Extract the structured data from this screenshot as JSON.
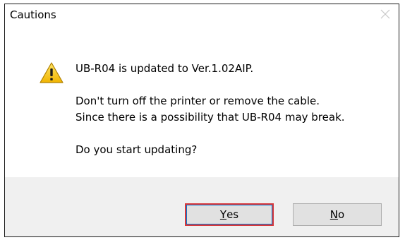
{
  "window": {
    "title": "Cautions"
  },
  "message": {
    "line1": "UB-R04 is updated to Ver.1.02AIP.",
    "line2": "Don't turn off the printer or remove the cable.",
    "line3": "Since there is a possibility that UB-R04 may break.",
    "line4": "Do you start updating?"
  },
  "buttons": {
    "yes": {
      "mnemonic": "Y",
      "rest": "es"
    },
    "no": {
      "mnemonic": "N",
      "rest": "o"
    }
  },
  "icons": {
    "warning": "warning-triangle-icon",
    "close": "close-icon"
  },
  "colors": {
    "highlight_border": "#d9383a",
    "warning_yellow": "#f5c518"
  }
}
